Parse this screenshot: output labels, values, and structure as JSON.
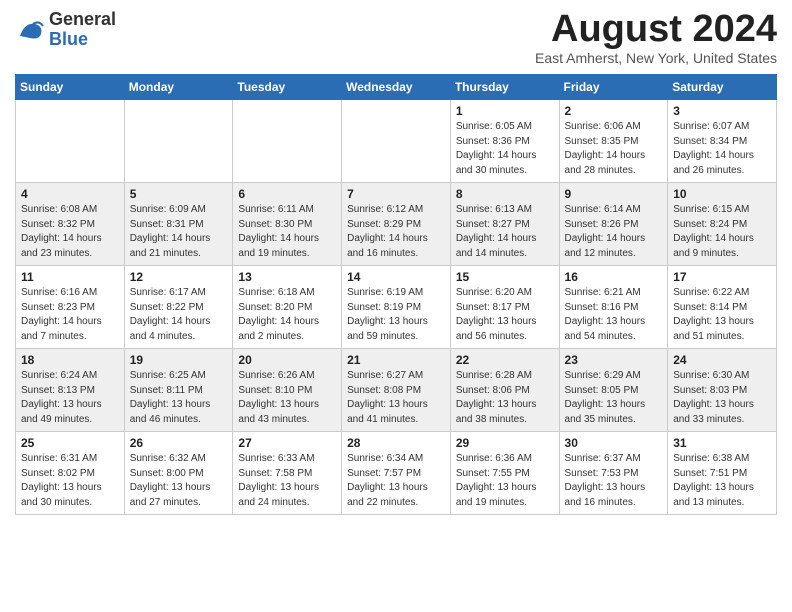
{
  "header": {
    "logo_line1": "General",
    "logo_line2": "Blue",
    "month_title": "August 2024",
    "location": "East Amherst, New York, United States"
  },
  "days_of_week": [
    "Sunday",
    "Monday",
    "Tuesday",
    "Wednesday",
    "Thursday",
    "Friday",
    "Saturday"
  ],
  "weeks": [
    [
      {
        "day": "",
        "info": ""
      },
      {
        "day": "",
        "info": ""
      },
      {
        "day": "",
        "info": ""
      },
      {
        "day": "",
        "info": ""
      },
      {
        "day": "1",
        "info": "Sunrise: 6:05 AM\nSunset: 8:36 PM\nDaylight: 14 hours\nand 30 minutes."
      },
      {
        "day": "2",
        "info": "Sunrise: 6:06 AM\nSunset: 8:35 PM\nDaylight: 14 hours\nand 28 minutes."
      },
      {
        "day": "3",
        "info": "Sunrise: 6:07 AM\nSunset: 8:34 PM\nDaylight: 14 hours\nand 26 minutes."
      }
    ],
    [
      {
        "day": "4",
        "info": "Sunrise: 6:08 AM\nSunset: 8:32 PM\nDaylight: 14 hours\nand 23 minutes."
      },
      {
        "day": "5",
        "info": "Sunrise: 6:09 AM\nSunset: 8:31 PM\nDaylight: 14 hours\nand 21 minutes."
      },
      {
        "day": "6",
        "info": "Sunrise: 6:11 AM\nSunset: 8:30 PM\nDaylight: 14 hours\nand 19 minutes."
      },
      {
        "day": "7",
        "info": "Sunrise: 6:12 AM\nSunset: 8:29 PM\nDaylight: 14 hours\nand 16 minutes."
      },
      {
        "day": "8",
        "info": "Sunrise: 6:13 AM\nSunset: 8:27 PM\nDaylight: 14 hours\nand 14 minutes."
      },
      {
        "day": "9",
        "info": "Sunrise: 6:14 AM\nSunset: 8:26 PM\nDaylight: 14 hours\nand 12 minutes."
      },
      {
        "day": "10",
        "info": "Sunrise: 6:15 AM\nSunset: 8:24 PM\nDaylight: 14 hours\nand 9 minutes."
      }
    ],
    [
      {
        "day": "11",
        "info": "Sunrise: 6:16 AM\nSunset: 8:23 PM\nDaylight: 14 hours\nand 7 minutes."
      },
      {
        "day": "12",
        "info": "Sunrise: 6:17 AM\nSunset: 8:22 PM\nDaylight: 14 hours\nand 4 minutes."
      },
      {
        "day": "13",
        "info": "Sunrise: 6:18 AM\nSunset: 8:20 PM\nDaylight: 14 hours\nand 2 minutes."
      },
      {
        "day": "14",
        "info": "Sunrise: 6:19 AM\nSunset: 8:19 PM\nDaylight: 13 hours\nand 59 minutes."
      },
      {
        "day": "15",
        "info": "Sunrise: 6:20 AM\nSunset: 8:17 PM\nDaylight: 13 hours\nand 56 minutes."
      },
      {
        "day": "16",
        "info": "Sunrise: 6:21 AM\nSunset: 8:16 PM\nDaylight: 13 hours\nand 54 minutes."
      },
      {
        "day": "17",
        "info": "Sunrise: 6:22 AM\nSunset: 8:14 PM\nDaylight: 13 hours\nand 51 minutes."
      }
    ],
    [
      {
        "day": "18",
        "info": "Sunrise: 6:24 AM\nSunset: 8:13 PM\nDaylight: 13 hours\nand 49 minutes."
      },
      {
        "day": "19",
        "info": "Sunrise: 6:25 AM\nSunset: 8:11 PM\nDaylight: 13 hours\nand 46 minutes."
      },
      {
        "day": "20",
        "info": "Sunrise: 6:26 AM\nSunset: 8:10 PM\nDaylight: 13 hours\nand 43 minutes."
      },
      {
        "day": "21",
        "info": "Sunrise: 6:27 AM\nSunset: 8:08 PM\nDaylight: 13 hours\nand 41 minutes."
      },
      {
        "day": "22",
        "info": "Sunrise: 6:28 AM\nSunset: 8:06 PM\nDaylight: 13 hours\nand 38 minutes."
      },
      {
        "day": "23",
        "info": "Sunrise: 6:29 AM\nSunset: 8:05 PM\nDaylight: 13 hours\nand 35 minutes."
      },
      {
        "day": "24",
        "info": "Sunrise: 6:30 AM\nSunset: 8:03 PM\nDaylight: 13 hours\nand 33 minutes."
      }
    ],
    [
      {
        "day": "25",
        "info": "Sunrise: 6:31 AM\nSunset: 8:02 PM\nDaylight: 13 hours\nand 30 minutes."
      },
      {
        "day": "26",
        "info": "Sunrise: 6:32 AM\nSunset: 8:00 PM\nDaylight: 13 hours\nand 27 minutes."
      },
      {
        "day": "27",
        "info": "Sunrise: 6:33 AM\nSunset: 7:58 PM\nDaylight: 13 hours\nand 24 minutes."
      },
      {
        "day": "28",
        "info": "Sunrise: 6:34 AM\nSunset: 7:57 PM\nDaylight: 13 hours\nand 22 minutes."
      },
      {
        "day": "29",
        "info": "Sunrise: 6:36 AM\nSunset: 7:55 PM\nDaylight: 13 hours\nand 19 minutes."
      },
      {
        "day": "30",
        "info": "Sunrise: 6:37 AM\nSunset: 7:53 PM\nDaylight: 13 hours\nand 16 minutes."
      },
      {
        "day": "31",
        "info": "Sunrise: 6:38 AM\nSunset: 7:51 PM\nDaylight: 13 hours\nand 13 minutes."
      }
    ]
  ]
}
